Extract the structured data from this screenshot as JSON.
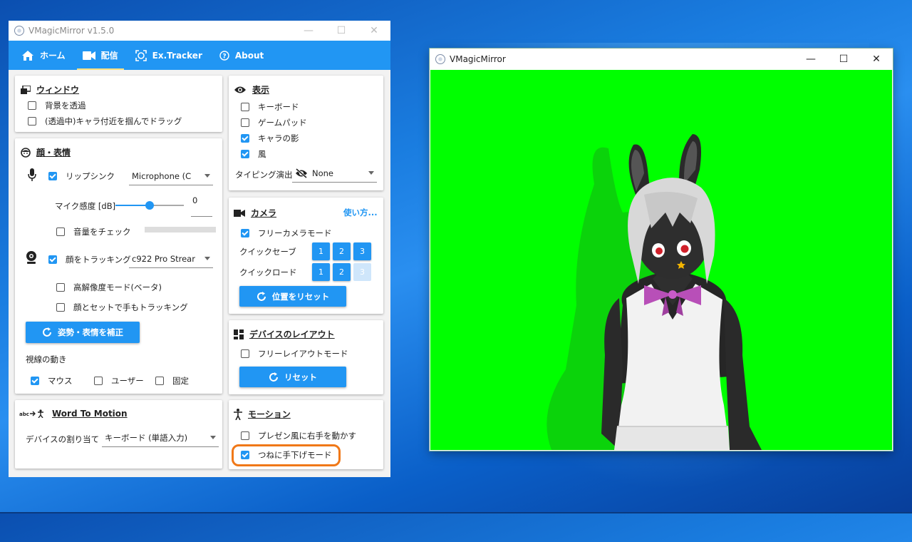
{
  "control_window": {
    "title": "VMagicMirror v1.5.0",
    "tabs": [
      {
        "label": "ホーム",
        "icon": "home-icon"
      },
      {
        "label": "配信",
        "icon": "video-camera-icon",
        "active": true
      },
      {
        "label": "Ex.Tracker",
        "icon": "face-tracker-icon"
      },
      {
        "label": "About",
        "icon": "help-circle-icon"
      }
    ],
    "window": {
      "title": "ウィンドウ",
      "transparent_bg": {
        "label": "背景を透過",
        "checked": false
      },
      "drag": {
        "label": "(透過中)キャラ付近を掴んでドラッグ",
        "checked": false
      }
    },
    "face": {
      "title": "顔・表情",
      "lipsync": {
        "label": "リップシンク",
        "checked": true,
        "device": "Microphone (C"
      },
      "mic_sensitivity": {
        "label": "マイク感度 [dB]",
        "value": "0",
        "level": 0.55
      },
      "volume_check": {
        "label": "音量をチェック",
        "checked": false
      },
      "face_tracking": {
        "label": "顔をトラッキング",
        "checked": true,
        "device": "c922 Pro Strear"
      },
      "high_res": {
        "label": "高解像度モード(ベータ)",
        "checked": false
      },
      "hand_tracking": {
        "label": "顔とセットで手もトラッキング",
        "checked": false
      },
      "calibrate_button": "姿勢・表情を補正",
      "gaze_label": "視線の動き",
      "gaze_options": [
        {
          "label": "マウス",
          "checked": true
        },
        {
          "label": "ユーザー",
          "checked": false
        },
        {
          "label": "固定",
          "checked": false
        }
      ]
    },
    "word_to_motion": {
      "title": "Word To Motion",
      "device_label": "デバイスの割り当て",
      "device_value": "キーボード (単語入力)"
    },
    "display": {
      "title": "表示",
      "keyboard": {
        "label": "キーボード",
        "checked": false
      },
      "gamepad": {
        "label": "ゲームパッド",
        "checked": false
      },
      "shadow": {
        "label": "キャラの影",
        "checked": true
      },
      "wind": {
        "label": "風",
        "checked": true
      },
      "typing_label": "タイピング演出",
      "typing_value": "None"
    },
    "camera": {
      "title": "カメラ",
      "help_link": "使い方...",
      "free_camera": {
        "label": "フリーカメラモード",
        "checked": true
      },
      "quick_save_label": "クイックセーブ",
      "quick_load_label": "クイックロード",
      "slots": [
        "1",
        "2",
        "3"
      ],
      "reset_button": "位置をリセット"
    },
    "layout": {
      "title": "デバイスのレイアウト",
      "free_layout": {
        "label": "フリーレイアウトモード",
        "checked": false
      },
      "reset_button": "リセット"
    },
    "motion": {
      "title": "モーション",
      "presenter": {
        "label": "プレゼン風に右手を動かす",
        "checked": false
      },
      "hands_down": {
        "label": "つねに手下げモード",
        "checked": true
      }
    }
  },
  "preview_window": {
    "title": "VMagicMirror",
    "background_color": "#00ff00"
  },
  "colors": {
    "accent": "#2196f3",
    "highlight": "#f07818"
  }
}
